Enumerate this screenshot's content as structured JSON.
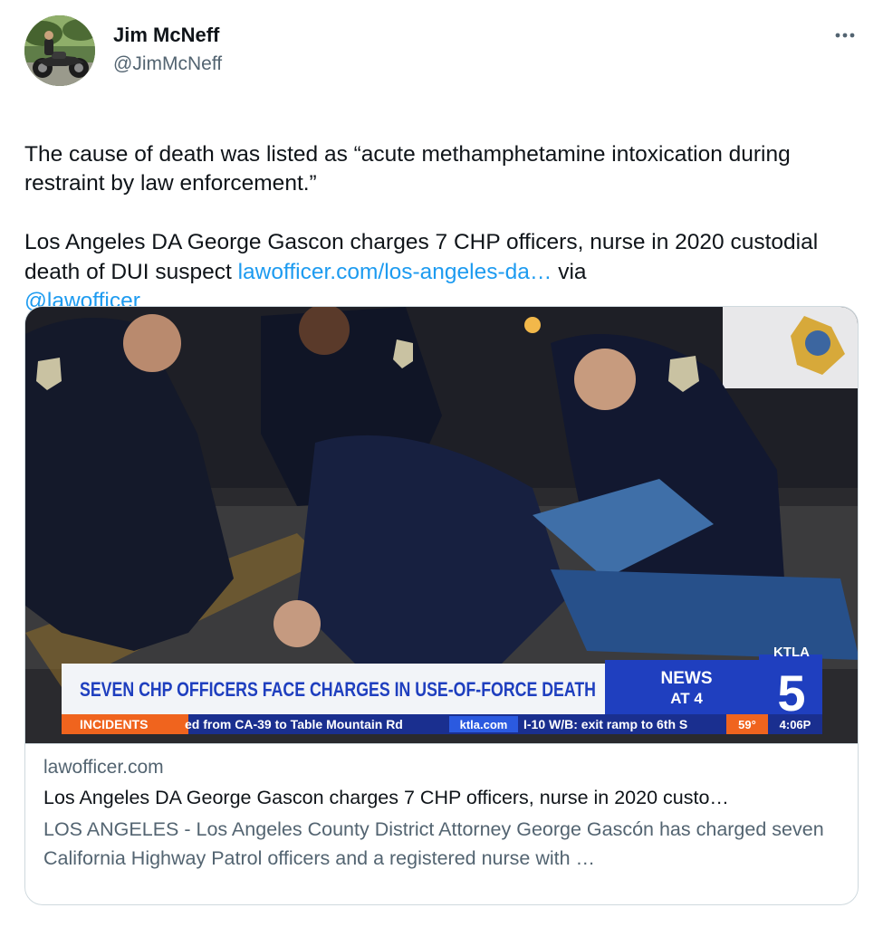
{
  "author": {
    "name": "Jim McNeff",
    "handle": "@JimMcNeff",
    "avatar_icon": "motorcycle-rider-avatar"
  },
  "more_icon": "more-horizontal-icon",
  "tweet": {
    "paragraph1": "The cause of death was listed as “acute methamphetamine intoxication during restraint by law enforcement.”",
    "paragraph2_text": "Los Angeles DA George Gascon charges 7 CHP officers, nurse in 2020 custodial death of DUI suspect ",
    "link_text": "lawofficer.com/los-angeles-da…",
    "via_text": " via",
    "mention": "@lawofficer"
  },
  "card": {
    "domain": "lawofficer.com",
    "title": "Los Angeles DA George Gascon charges 7 CHP officers, nurse in 2020 custo…",
    "description": "LOS ANGELES - Los Angeles County District Attorney George Gascón has charged seven California Highway Patrol officers and a registered nurse with …",
    "image": {
      "headline": "SEVEN CHP OFFICERS FACE CHARGES IN USE-OF-FORCE DEATH",
      "news_label_1": "NEWS",
      "news_label_2": "AT 4",
      "station": "KTLA",
      "channel": "5",
      "ticker_tag": "INCIDENTS",
      "ticker_text": "ed from CA-39 to Table Mountain Rd",
      "ticker_site": "ktla.com",
      "ticker_text_2": "I-10 W/B: exit ramp to 6th S",
      "temperature": "59°",
      "time": "4:06P"
    }
  },
  "colors": {
    "text": "#0f1419",
    "secondary": "#536471",
    "link": "#1d9bf0",
    "border": "#cfd9de",
    "chyron_blue": "#1f3fbf",
    "chyron_orange": "#f0641e"
  }
}
